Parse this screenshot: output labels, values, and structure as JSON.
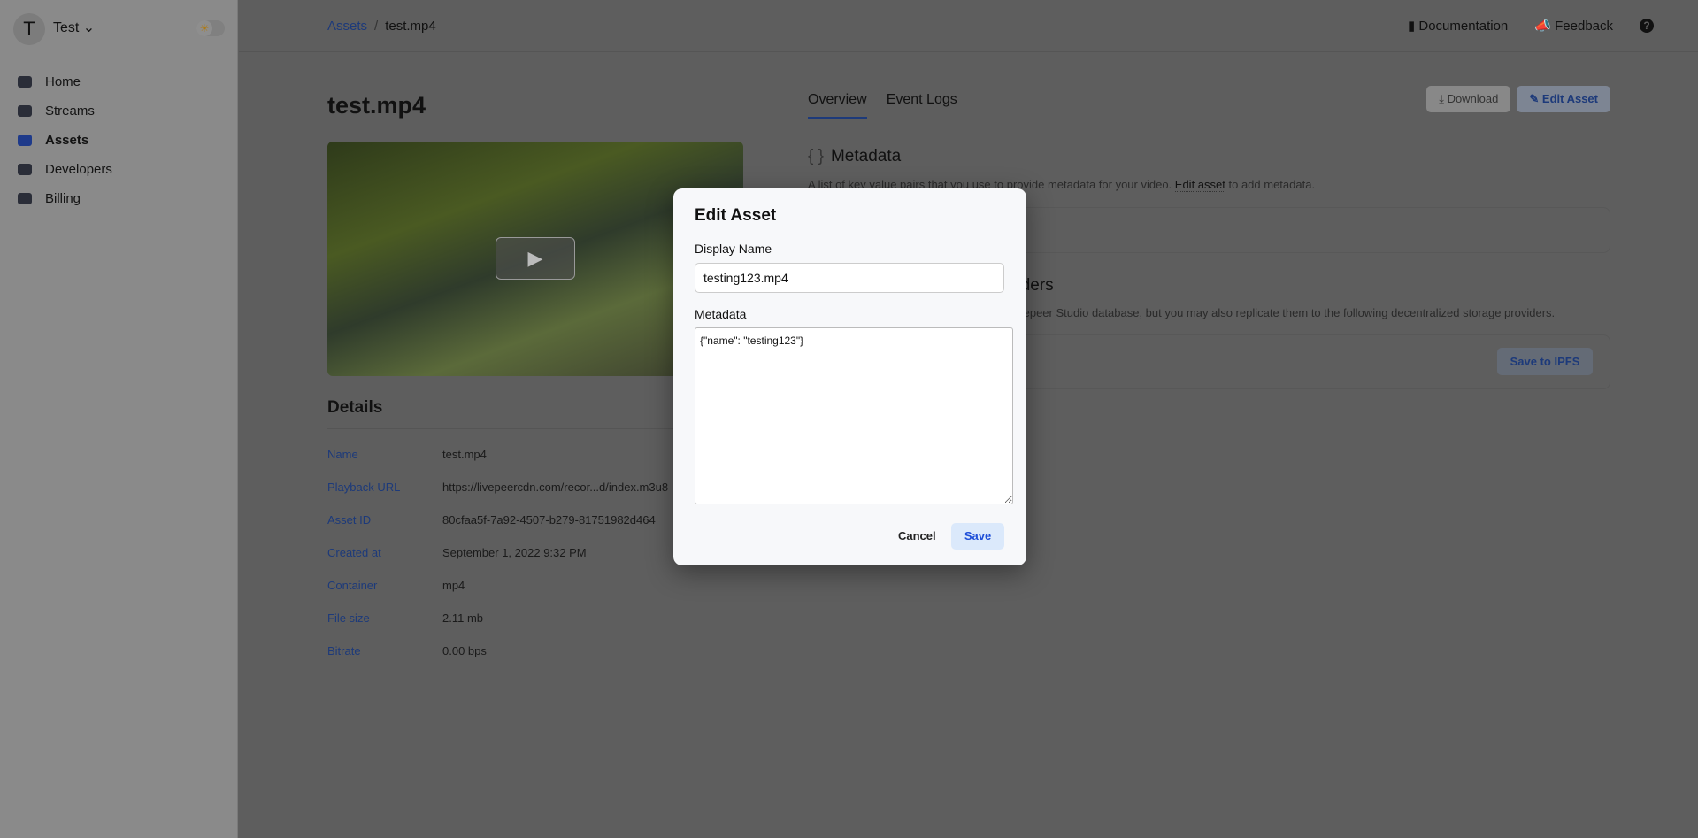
{
  "sidebar": {
    "avatar": "T",
    "workspace": "Test",
    "items": [
      {
        "label": "Home",
        "icon": "home-icon"
      },
      {
        "label": "Streams",
        "icon": "streams-icon"
      },
      {
        "label": "Assets",
        "icon": "assets-icon",
        "active": true
      },
      {
        "label": "Developers",
        "icon": "terminal-icon"
      },
      {
        "label": "Billing",
        "icon": "billing-icon"
      }
    ]
  },
  "header": {
    "breadcrumb": [
      "Assets",
      "test.mp4"
    ],
    "links": [
      "Documentation",
      "Feedback"
    ],
    "help": "?"
  },
  "asset": {
    "title": "test.mp4",
    "details_title": "Details",
    "details": [
      {
        "k": "Name",
        "v": "test.mp4"
      },
      {
        "k": "Playback URL",
        "v": "https://livepeercdn.com/recor...d/index.m3u8"
      },
      {
        "k": "Asset ID",
        "v": "80cfaa5f-7a92-4507-b279-81751982d464"
      },
      {
        "k": "Created at",
        "v": "September 1, 2022 9:32 PM"
      },
      {
        "k": "Container",
        "v": "mp4"
      },
      {
        "k": "File size",
        "v": "2.11 mb"
      },
      {
        "k": "Bitrate",
        "v": "0.00 bps"
      }
    ]
  },
  "tabs": [
    "Overview",
    "Event Logs"
  ],
  "actions": {
    "download": "Download",
    "edit": "Edit Asset"
  },
  "metadata": {
    "title": "Metadata",
    "desc_pre": "A list of key value pairs that you use to provide metadata for your video. ",
    "desc_link": "Edit asset",
    "desc_post": " to add metadata."
  },
  "storage": {
    "title_fragment": "viders",
    "desc_fragment": "Livepeer Studio database, but you may also replicate them to the following decentralized storage providers.",
    "button": "Save to IPFS"
  },
  "modal": {
    "title": "Edit Asset",
    "name_label": "Display Name",
    "name_value": "testing123.mp4",
    "meta_label": "Metadata",
    "meta_value": "{\"name\": \"testing123\"}",
    "cancel": "Cancel",
    "save": "Save"
  }
}
